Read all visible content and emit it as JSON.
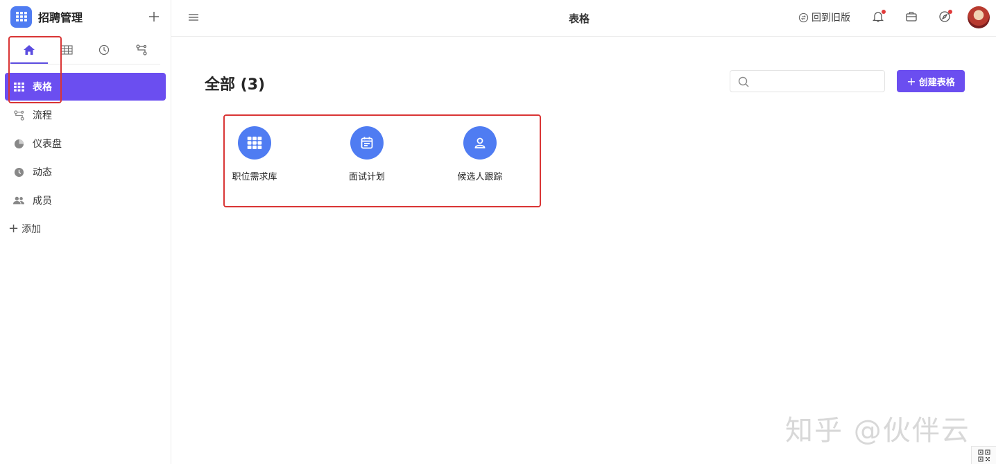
{
  "app": {
    "title": "招聘管理",
    "accent_color": "#6b4ef0",
    "icon_color": "#4f7cf2"
  },
  "sidebar": {
    "icon_tabs": [
      {
        "name": "home-icon",
        "active": true
      },
      {
        "name": "table-icon",
        "active": false
      },
      {
        "name": "clock-icon",
        "active": false
      },
      {
        "name": "flow-icon",
        "active": false
      }
    ],
    "items": [
      {
        "label": "表格",
        "icon": "grid-icon",
        "active": true
      },
      {
        "label": "流程",
        "icon": "flow-icon",
        "active": false
      },
      {
        "label": "仪表盘",
        "icon": "pie-icon",
        "active": false
      },
      {
        "label": "动态",
        "icon": "clock-icon",
        "active": false
      },
      {
        "label": "成员",
        "icon": "users-icon",
        "active": false
      }
    ],
    "add_label": "添加"
  },
  "topbar": {
    "title": "表格",
    "back_old_label": "回到旧版"
  },
  "main": {
    "title": "全部 (3)",
    "search_placeholder": "",
    "create_label": "创建表格",
    "tables": [
      {
        "label": "职位需求库",
        "icon": "grid-icon"
      },
      {
        "label": "面试计划",
        "icon": "calendar-icon"
      },
      {
        "label": "候选人跟踪",
        "icon": "person-icon"
      }
    ]
  },
  "watermark": "知乎 @伙伴云"
}
